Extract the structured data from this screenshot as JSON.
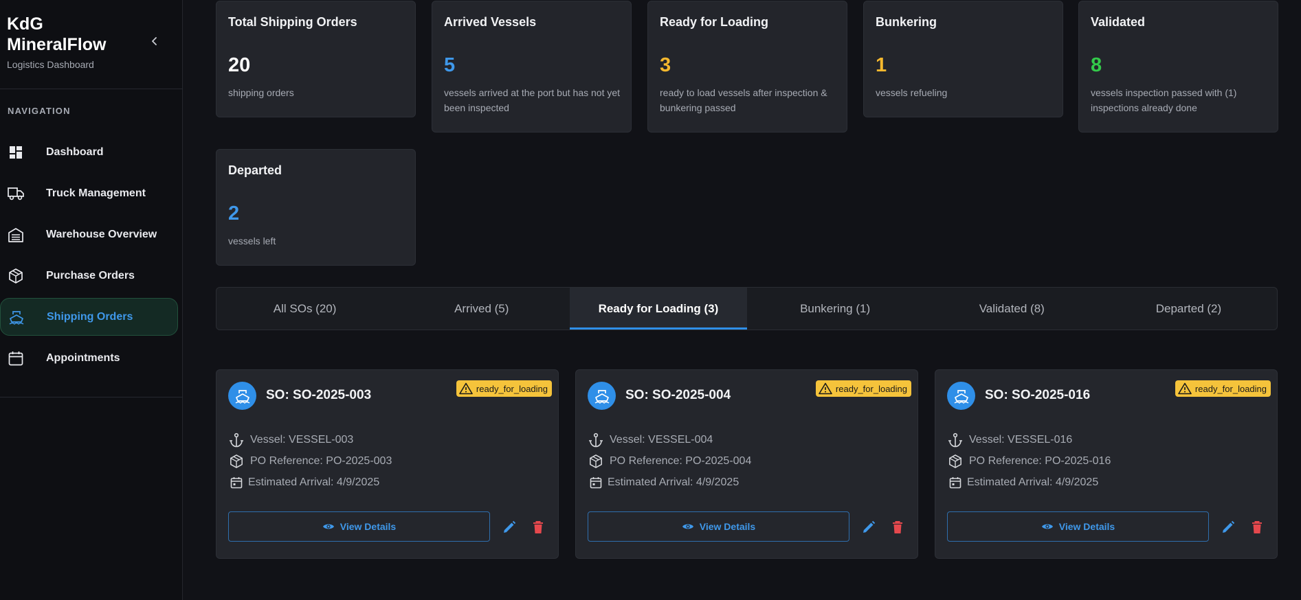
{
  "brand": {
    "title_line1": "KdG",
    "title_line2": "MineralFlow",
    "subtitle": "Logistics Dashboard"
  },
  "sidebar": {
    "heading": "NAVIGATION",
    "items": [
      {
        "label": "Dashboard",
        "icon": "dashboard-icon"
      },
      {
        "label": "Truck Management",
        "icon": "truck-icon"
      },
      {
        "label": "Warehouse Overview",
        "icon": "warehouse-icon"
      },
      {
        "label": "Purchase Orders",
        "icon": "package-icon"
      },
      {
        "label": "Shipping Orders",
        "icon": "ship-icon",
        "active": true
      },
      {
        "label": "Appointments",
        "icon": "calendar-icon"
      }
    ]
  },
  "stats": [
    {
      "title": "Total Shipping Orders",
      "value": "20",
      "desc": "shipping orders",
      "color": "#ffffff"
    },
    {
      "title": "Arrived Vessels",
      "value": "5",
      "desc": "vessels arrived at the port but has not yet been inspected",
      "color": "#3f98ea"
    },
    {
      "title": "Ready for Loading",
      "value": "3",
      "desc": "ready to load vessels after inspection & bunkering passed",
      "color": "#f5b82e"
    },
    {
      "title": "Bunkering",
      "value": "1",
      "desc": "vessels refueling",
      "color": "#f5b82e"
    },
    {
      "title": "Validated",
      "value": "8",
      "desc": "vessels inspection passed with (1) inspections already done",
      "color": "#33c94a"
    },
    {
      "title": "Departed",
      "value": "2",
      "desc": "vessels left",
      "color": "#3f98ea"
    }
  ],
  "tabs": [
    {
      "label": "All SOs (20)"
    },
    {
      "label": "Arrived (5)"
    },
    {
      "label": "Ready for Loading (3)",
      "active": true
    },
    {
      "label": "Bunkering (1)"
    },
    {
      "label": "Validated (8)"
    },
    {
      "label": "Departed (2)"
    }
  ],
  "orders": [
    {
      "title": "SO: SO-2025-003",
      "status": "ready_for_loading",
      "vessel": "Vessel: VESSEL-003",
      "po": "PO Reference: PO-2025-003",
      "eta": "Estimated Arrival: 4/9/2025",
      "view_label": "View Details"
    },
    {
      "title": "SO: SO-2025-004",
      "status": "ready_for_loading",
      "vessel": "Vessel: VESSEL-004",
      "po": "PO Reference: PO-2025-004",
      "eta": "Estimated Arrival: 4/9/2025",
      "view_label": "View Details"
    },
    {
      "title": "SO: SO-2025-016",
      "status": "ready_for_loading",
      "vessel": "Vessel: VESSEL-016",
      "po": "PO Reference: PO-2025-016",
      "eta": "Estimated Arrival: 4/9/2025",
      "view_label": "View Details"
    }
  ],
  "colors": {
    "accent": "#2f8fe8",
    "status_warning": "#f5c33b",
    "delete": "#e5484d"
  }
}
